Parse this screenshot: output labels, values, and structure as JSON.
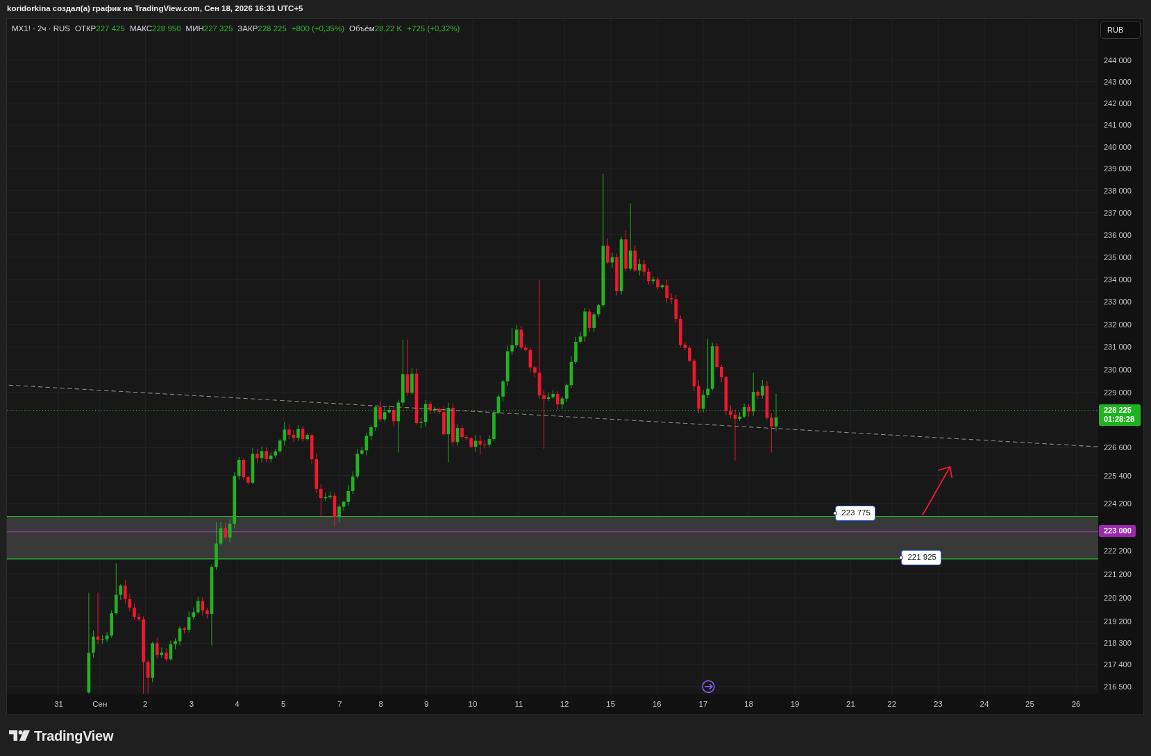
{
  "window": {
    "title": "koridorkina создал(а) график на TradingView.com, Сен 18, 2026 16:31 UTC+5"
  },
  "legend": {
    "symbol": "MX1! · 2ч · RUS",
    "fields": [
      {
        "label": "ОТКР",
        "value": "227 425"
      },
      {
        "label": "МАКС",
        "value": "228 950"
      },
      {
        "label": "МИН",
        "value": "227 325"
      },
      {
        "label": "ЗАКР",
        "value": "228 225"
      }
    ],
    "change": "+800 (+0,35%)",
    "volume": {
      "label": "Объём",
      "value": "28,22 K",
      "change": "+725 (+0,32%)"
    }
  },
  "drawings": {
    "price_labels": [
      {
        "value": "223 775"
      },
      {
        "value": "221 925"
      }
    ]
  },
  "price_axis": {
    "currency_button": "RUB",
    "labels": [
      "244 000",
      "243 000",
      "242 000",
      "241 000",
      "240 000",
      "239 000",
      "238 000",
      "237 000",
      "236 000",
      "235 000",
      "234 000",
      "233 000",
      "232 000",
      "231 000",
      "230 000",
      "229 000",
      "226 600",
      "225 400",
      "224 200",
      "222 200",
      "221 200",
      "220 200",
      "219 200",
      "218 300",
      "217 400",
      "216 500"
    ],
    "last_price": {
      "value": "228 225",
      "countdown": "01:28:28"
    },
    "level_badge": "223 000"
  },
  "time_axis": {
    "labels": [
      "31",
      "Сен",
      "2",
      "3",
      "4",
      "5",
      "7",
      "8",
      "9",
      "10",
      "11",
      "12",
      "15",
      "16",
      "17",
      "18",
      "19",
      "21",
      "22",
      "23",
      "24",
      "25",
      "26"
    ]
  },
  "footer": {
    "logo_text": "TradingView"
  }
}
